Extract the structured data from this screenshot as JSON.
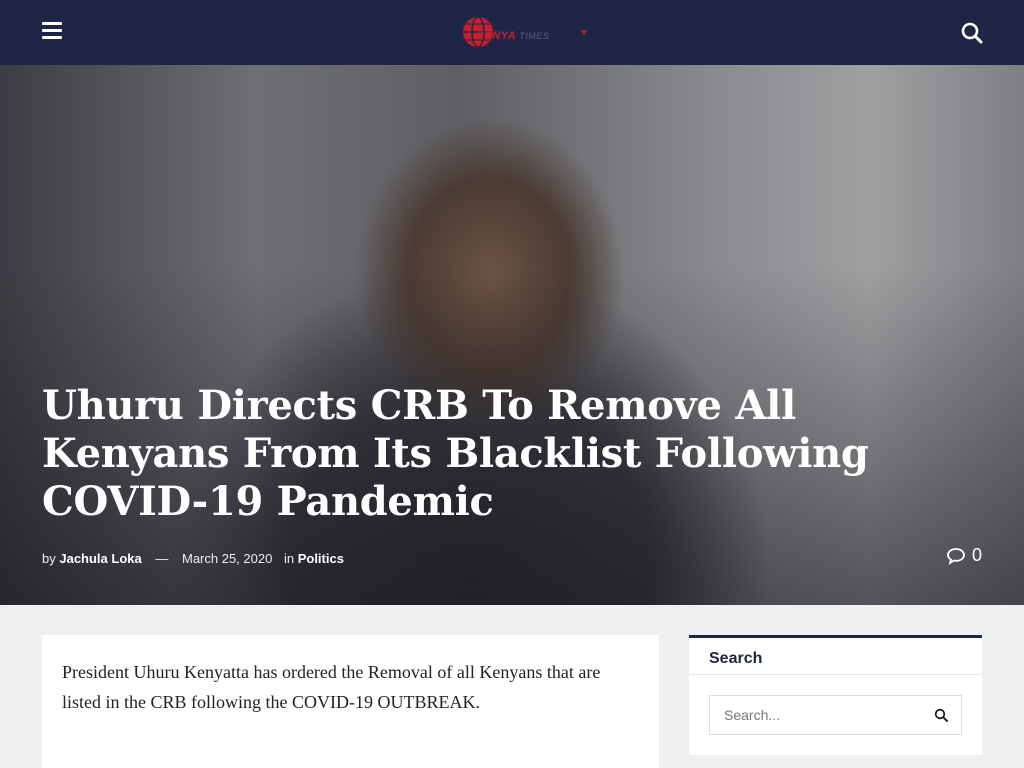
{
  "header": {
    "logo_text_primary": "KENYA",
    "logo_text_secondary": "TIMES",
    "icons": [
      "hamburger-menu-icon",
      "search-icon"
    ],
    "background_color": "#1f2544"
  },
  "hero": {
    "title": "Uhuru Directs CRB To Remove All Kenyans From Its Blacklist Following COVID-19 Pandemic",
    "by": "by",
    "author": "Jachula Loka",
    "separator": "—",
    "date": "March 25, 2020",
    "in": "in",
    "category": "Politics",
    "comment_count": "0"
  },
  "article": {
    "paragraph_1": "President Uhuru Kenyatta has ordered the Removal of all Kenyans that are listed in the CRB following the COVID-19 OUTBREAK."
  },
  "sidebar": {
    "search_widget": {
      "title": "Search",
      "placeholder": "Search..."
    }
  },
  "colors": {
    "accent": "#1f2544",
    "logo_red": "#c4202f"
  }
}
